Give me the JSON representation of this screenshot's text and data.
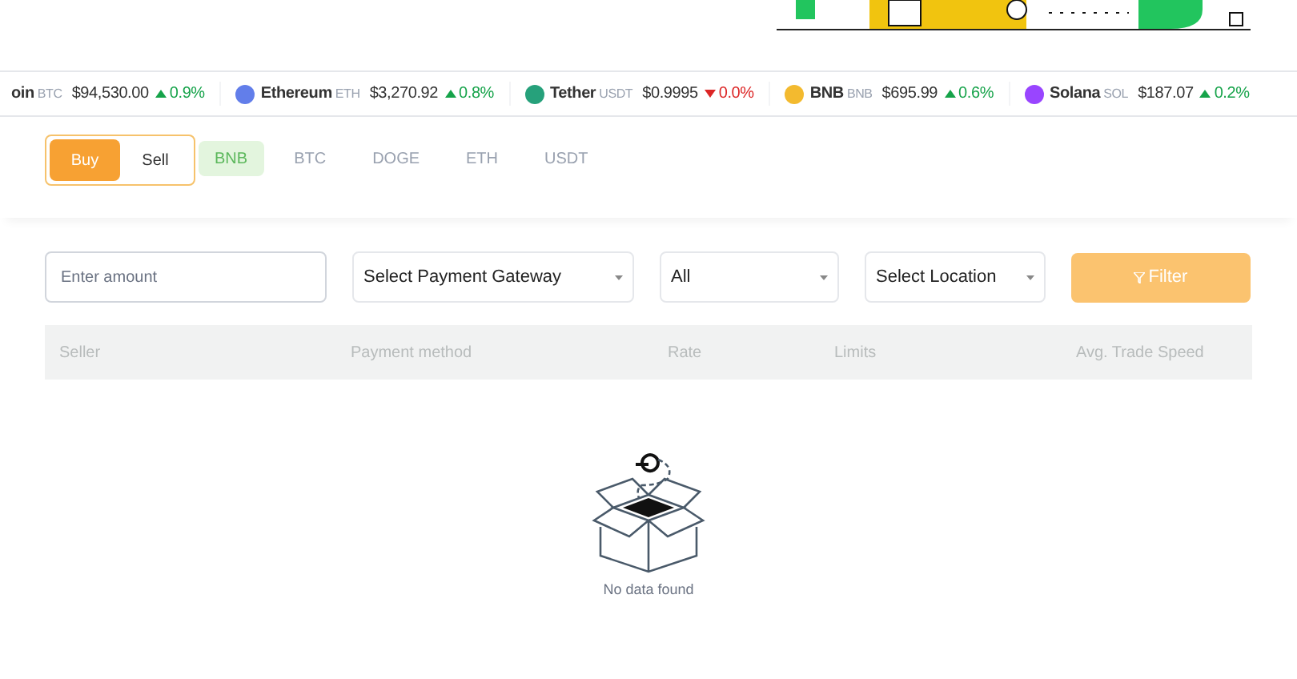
{
  "ticker": [
    {
      "name": "oin",
      "symbol": "BTC",
      "price": "$94,530.00",
      "change": "0.9%",
      "rising": true
    },
    {
      "name": "Ethereum",
      "symbol": "ETH",
      "price": "$3,270.92",
      "change": "0.8%",
      "rising": true,
      "color": "#627eea"
    },
    {
      "name": "Tether",
      "symbol": "USDT",
      "price": "$0.9995",
      "change": "0.0%",
      "rising": false,
      "color": "#26a17b"
    },
    {
      "name": "BNB",
      "symbol": "BNB",
      "price": "$695.99",
      "change": "0.6%",
      "rising": true,
      "color": "#f3ba2f"
    },
    {
      "name": "Solana",
      "symbol": "SOL",
      "price": "$187.07",
      "change": "0.2%",
      "rising": true,
      "color": "#9945ff"
    }
  ],
  "trade_tabs": [
    {
      "label": "Buy",
      "selected": true
    },
    {
      "label": "Sell",
      "selected": false
    }
  ],
  "coin_tabs": [
    {
      "label": "BNB",
      "selected": true
    },
    {
      "label": "BTC",
      "selected": false
    },
    {
      "label": "DOGE",
      "selected": false
    },
    {
      "label": "ETH",
      "selected": false
    },
    {
      "label": "USDT",
      "selected": false
    }
  ],
  "filters": {
    "amount": {
      "placeholder": "Enter amount"
    },
    "payment_gateway": "Select Payment Gateway",
    "type": "All",
    "location": "Select Location",
    "button": "Filter"
  },
  "table": {
    "columns": [
      "Seller",
      "Payment method",
      "Rate",
      "Limits",
      "Avg. Trade Speed"
    ],
    "empty_text": "No data found"
  }
}
